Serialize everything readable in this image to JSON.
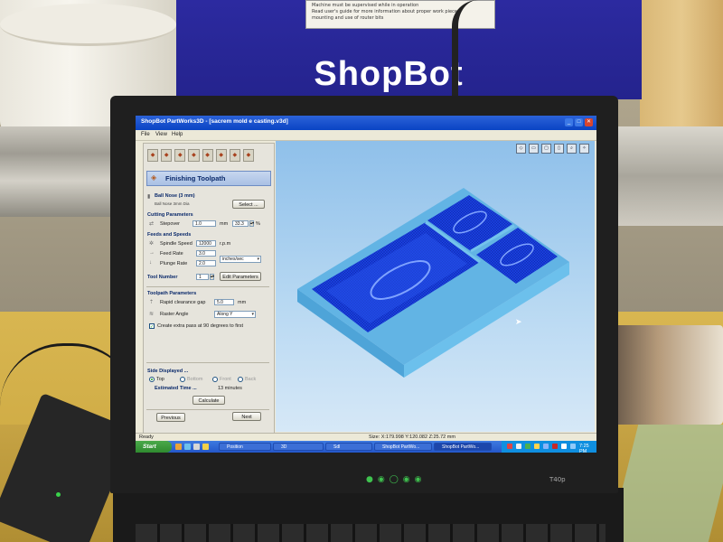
{
  "background": {
    "warning_lines": [
      "Machine must be supervised while in operation",
      "Read user's guide for more information about proper work piece",
      "mounting and use of router bits"
    ],
    "logo": "ShopBot"
  },
  "laptop": {
    "model": "T40p"
  },
  "window": {
    "title": "ShopBot PartWorks3D - [sacrem mold e casting.v3d]",
    "menu": [
      "File",
      "View",
      "Help"
    ]
  },
  "panel": {
    "header": "Finishing Toolpath",
    "tool": {
      "name": "Ball Nose (3 mm)",
      "desc": "Ball Nose 3mm Dia",
      "select_label": "Select ..."
    },
    "cutting": {
      "title": "Cutting Parameters",
      "stepover_label": "Stepover",
      "stepover_value": "1.0",
      "stepover_unit": "mm",
      "stepover_pct": "33.3",
      "pct_sign": "%"
    },
    "feeds": {
      "title": "Feeds and Speeds",
      "spindle_label": "Spindle Speed",
      "spindle_value": "12000",
      "spindle_unit": "r.p.m",
      "feed_label": "Feed Rate",
      "feed_value": "3.0",
      "plunge_label": "Plunge Rate",
      "plunge_value": "2.0",
      "rate_unit": "inches/sec"
    },
    "tool_number": {
      "label": "Tool Number",
      "value": "1",
      "edit_label": "Edit Parameters"
    },
    "toolpath": {
      "title": "Toolpath Parameters",
      "clearance_label": "Rapid clearance gap",
      "clearance_value": "5.0",
      "clearance_unit": "mm",
      "raster_label": "Raster Angle",
      "raster_value": "Along Y",
      "extra_pass_label": "Create extra pass at 90 degrees to first"
    },
    "side": {
      "title": "Side Displayed ...",
      "options": [
        "Top",
        "Bottom",
        "Front",
        "Back"
      ]
    },
    "estimate": {
      "label": "Estimated Time ...",
      "value": "13 minutes"
    },
    "calculate_label": "Calculate",
    "previous_label": "Previous",
    "next_label": "Next"
  },
  "status": {
    "left": "Ready",
    "size": "Size: X:179.998 Y:120.082 Z:25.72 mm"
  },
  "taskbar": {
    "start": "Start",
    "items": [
      "Position",
      "3D",
      "Sdl",
      "ShopBot PartWo...",
      "ShopBot PartWo..."
    ],
    "clock": "7:25 PM"
  },
  "colors": {
    "xp_blue": "#2457c9",
    "model_blue": "#1a3fe0",
    "model_cyan": "#5ab7e6",
    "machine_panel": "#26248f"
  }
}
